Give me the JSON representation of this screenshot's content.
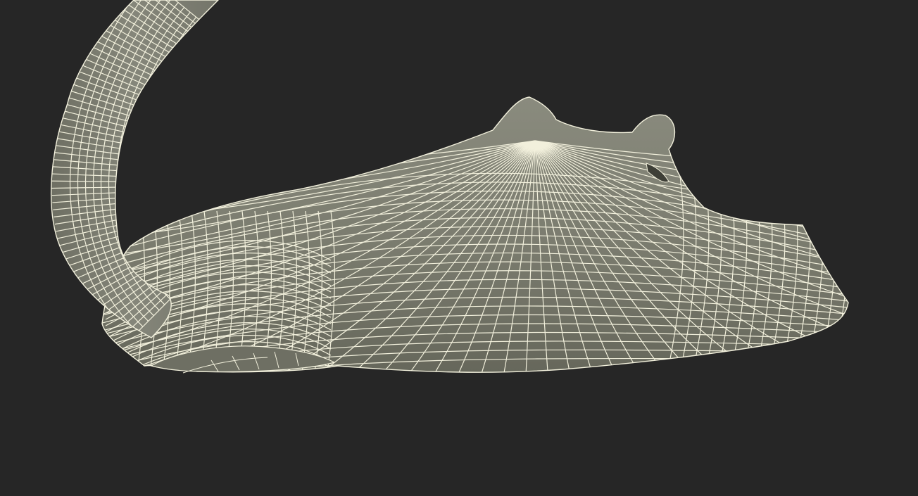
{
  "scene": {
    "subject": "stingray-wireframe-model",
    "colors": {
      "background": "#262626",
      "body_fill": "#7a7b6e",
      "body_fill_light": "#8a8b7e",
      "body_fill_dark": "#5e5f54",
      "wire": "#f2f0dc",
      "shadow": "#4f5047"
    }
  }
}
